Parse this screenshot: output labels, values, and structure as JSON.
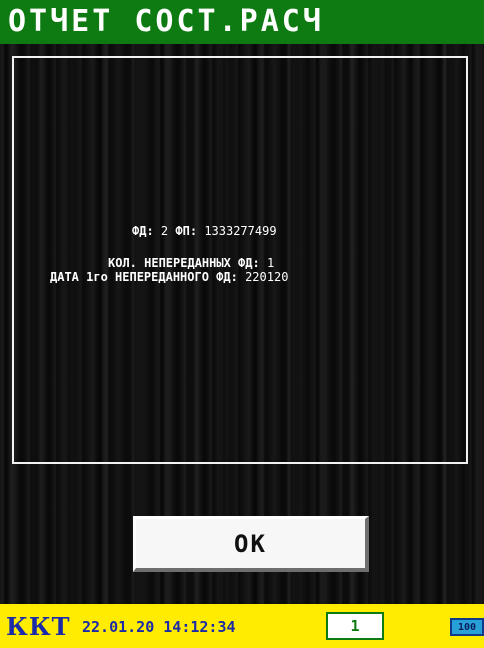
{
  "header": {
    "title": "ОТЧЕТ СОСТ.РАСЧ"
  },
  "report": {
    "fd_label": "ФД:",
    "fd_value": "2",
    "fp_label": "ФП:",
    "fp_value": "1333277499",
    "unsent_count_label": "КОЛ. НЕПЕРЕДАННЫХ ФД:",
    "unsent_count_value": "1",
    "first_unsent_date_label": "ДАТА 1го НЕПЕРЕДАННОГО ФД:",
    "first_unsent_date_value": "220120"
  },
  "actions": {
    "ok_label": "OK"
  },
  "status": {
    "mode": "ККТ",
    "datetime": "22.01.20 14:12:34",
    "counter": "1",
    "battery": "100"
  },
  "colors": {
    "title_bar": "#0e7a12",
    "status_bar": "#ffec00",
    "status_text": "#1a2aa8",
    "battery": "#27a0d8"
  }
}
